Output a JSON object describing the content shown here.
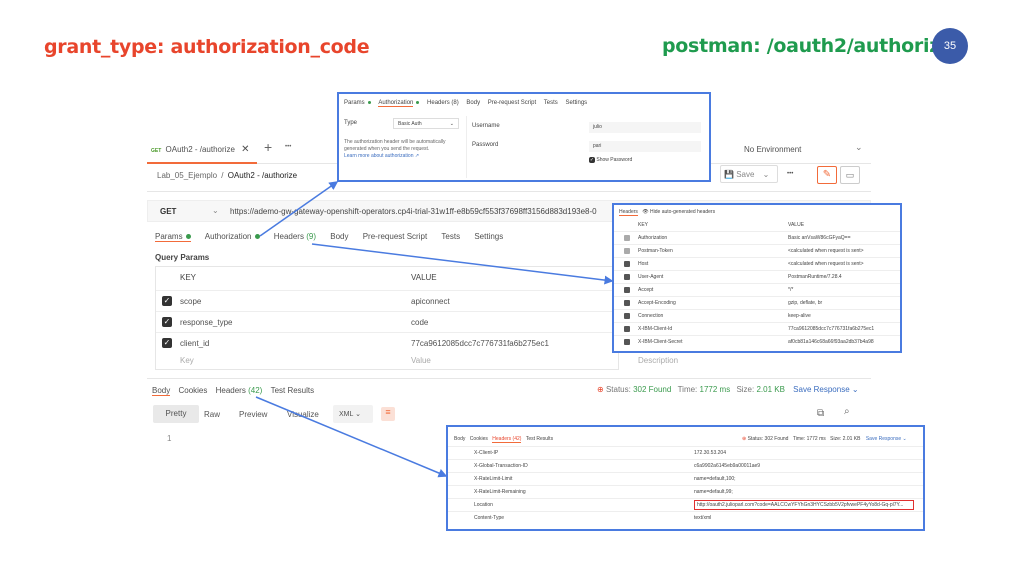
{
  "slide": {
    "left_title": "grant_type: authorization_code",
    "right_title": "postman: /oauth2/authorize",
    "page_number": "35"
  },
  "postman": {
    "tab_method": "GET",
    "tab_title": "OAuth2 - /authorize",
    "new_tab": "+",
    "more": "•••",
    "environment": "No Environment",
    "breadcrumb_parent": "Lab_05_Ejemplo",
    "breadcrumb_sep": "/",
    "breadcrumb_current": "OAuth2 - /authorize",
    "save_label": "Save",
    "method": "GET",
    "url": "https://ademo-gw-gateway-openshift-operators.cp4i-trial-31w1ff-e8b59cf553f37698ff3156d883d193e8-0",
    "tabs": {
      "params": "Params",
      "authorization": "Authorization",
      "headers": "Headers",
      "headers_count": "(9)",
      "body": "Body",
      "prerequest": "Pre-request Script",
      "tests": "Tests",
      "settings": "Settings"
    },
    "query_params": "Query Params",
    "col_key": "KEY",
    "col_value": "VALUE",
    "col_description": "Description",
    "params": [
      {
        "key": "scope",
        "value": "apiconnect"
      },
      {
        "key": "response_type",
        "value": "code"
      },
      {
        "key": "client_id",
        "value": "77ca9612085dcc7c776731fa6b275ec1"
      }
    ],
    "placeholder_key": "Key",
    "placeholder_value": "Value",
    "resp_tabs": {
      "body": "Body",
      "cookies": "Cookies",
      "headers": "Headers",
      "headers_count": "(42)",
      "test_results": "Test Results"
    },
    "status_label": "Status:",
    "status": "302 Found",
    "time_label": "Time:",
    "time": "1772 ms",
    "size_label": "Size:",
    "size": "2.01 KB",
    "save_response": "Save Response",
    "view_pretty": "Pretty",
    "view_raw": "Raw",
    "view_preview": "Preview",
    "view_visualize": "Visualize",
    "format": "XML",
    "line1": "1"
  },
  "auth_popup": {
    "tabs": {
      "params": "Params",
      "authorization": "Authorization",
      "headers": "Headers (8)",
      "body": "Body",
      "prerequest": "Pre-request Script",
      "tests": "Tests",
      "settings": "Settings"
    },
    "type_label": "Type",
    "type_value": "Basic Auth",
    "note": "The authorization header will be automatically generated when you send the request.",
    "learn_more": "Learn more about authorization ↗",
    "username_label": "Username",
    "username_value": "julio",
    "password_label": "Password",
    "password_value": "pari",
    "show_password": "Show Password"
  },
  "headers_popup": {
    "tab": "Headers",
    "hide_label": "Hide auto-generated headers",
    "col_key": "KEY",
    "col_value": "VALUE",
    "rows": [
      {
        "key": "Authorization",
        "value": "Basic anVsaW86cGFyaQ=="
      },
      {
        "key": "Postman-Token",
        "value": "<calculated when request is sent>"
      },
      {
        "key": "Host",
        "value": "<calculated when request is sent>"
      },
      {
        "key": "User-Agent",
        "value": "PostmanRuntime/7.28.4"
      },
      {
        "key": "Accept",
        "value": "*/*"
      },
      {
        "key": "Accept-Encoding",
        "value": "gzip, deflate, br"
      },
      {
        "key": "Connection",
        "value": "keep-alive"
      },
      {
        "key": "X-IBM-Client-Id",
        "value": "77ca9612085dcc7c776731fa6b275ec1"
      },
      {
        "key": "X-IBM-Client-Secret",
        "value": "af0cb81a146c68a66f93aa2db37b4a98"
      }
    ]
  },
  "resp_popup": {
    "tabs": {
      "body": "Body",
      "cookies": "Cookies",
      "headers": "Headers (42)",
      "test_results": "Test Results"
    },
    "status": "Status: 302 Found",
    "time": "Time: 1772 ms",
    "size": "Size: 2.01 KB",
    "save_response": "Save Response",
    "rows": [
      {
        "key": "X-Client-IP",
        "value": "172.30.53.204"
      },
      {
        "key": "X-Global-Transaction-ID",
        "value": "c6a9902a6145eb9a00011ae9"
      },
      {
        "key": "X-RateLimit-Limit",
        "value": "name=default,100;"
      },
      {
        "key": "X-RateLimit-Remaining",
        "value": "name=default,99;"
      },
      {
        "key": "Location",
        "value": "http://oauth2.julioparl.com?code=AALCCwYFYhGn3HYCSzbb5V2pfvwePF4yYo8d-Gq-pl7Y..."
      },
      {
        "key": "Content-Type",
        "value": "text/xml"
      }
    ]
  },
  "colors": {
    "orange": "#e8452c",
    "green": "#1f9b4e",
    "blue": "#3b5ba9",
    "highlight": "#4a7be0",
    "red_box": "#e03030"
  }
}
